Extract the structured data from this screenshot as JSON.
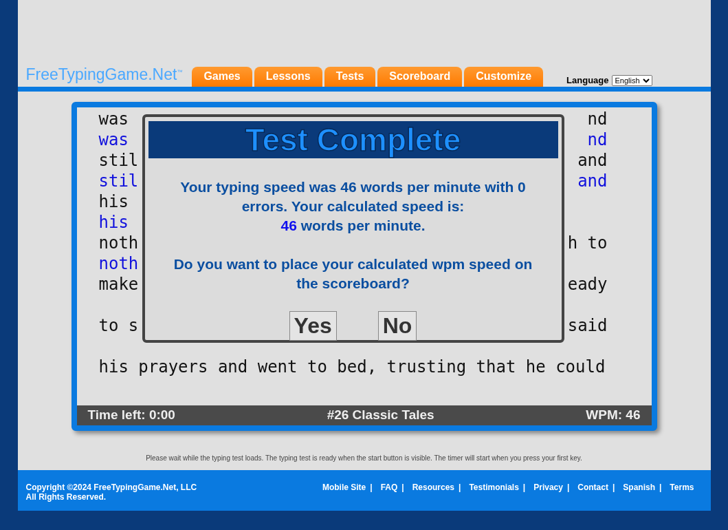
{
  "logo": {
    "text": "FreeTypingGame.Net",
    "mark": "™"
  },
  "nav_tabs": [
    {
      "label": "Games"
    },
    {
      "label": "Lessons"
    },
    {
      "label": "Tests"
    },
    {
      "label": "Scoreboard"
    },
    {
      "label": "Customize"
    }
  ],
  "language": {
    "label": "Language",
    "value": "English"
  },
  "typing_text": [
    {
      "kind": "source",
      "left": "was",
      "right": "nd"
    },
    {
      "kind": "typed",
      "left": "was",
      "right": "nd"
    },
    {
      "kind": "source",
      "left": "stil",
      "right": "and"
    },
    {
      "kind": "typed",
      "left": "stil",
      "right": "and"
    },
    {
      "kind": "source",
      "left": "his"
    },
    {
      "kind": "typed",
      "left": "his"
    },
    {
      "kind": "source",
      "left": "noth",
      "right": "h to"
    },
    {
      "kind": "typed",
      "left": "noth"
    },
    {
      "kind": "source",
      "left": "make",
      "right": "eady"
    },
    {
      "kind": "blank"
    },
    {
      "kind": "source",
      "left": "to s",
      "right": "said"
    },
    {
      "kind": "blank"
    },
    {
      "kind": "source",
      "left": "his prayers and went to bed, trusting that he could"
    }
  ],
  "status_bar": {
    "time_left": "Time left: 0:00",
    "test_name": "#26 Classic Tales",
    "wpm": "WPM: 46"
  },
  "dialog": {
    "title": "Test Complete",
    "result": "Your typing speed was 46 words per minute with 0 errors. Your calculated speed is:",
    "speed_value": "46",
    "speed_unit": "words per minute.",
    "question": "Do you want to place your calculated wpm speed on the scoreboard?",
    "buttons": [
      "Yes",
      "No"
    ]
  },
  "notice": "Please wait while the typing test loads. The typing test is ready when the start button is visible. The timer will start when you press your first key.",
  "footer": {
    "copyright": [
      "Copyright ©2024 FreeTypingGame.Net, LLC",
      "All Rights Reserved."
    ],
    "separator": "|",
    "links": [
      "Mobile Site",
      "FAQ",
      "Resources",
      "Testimonials",
      "Privacy",
      "Contact",
      "Spanish",
      "Terms"
    ]
  }
}
